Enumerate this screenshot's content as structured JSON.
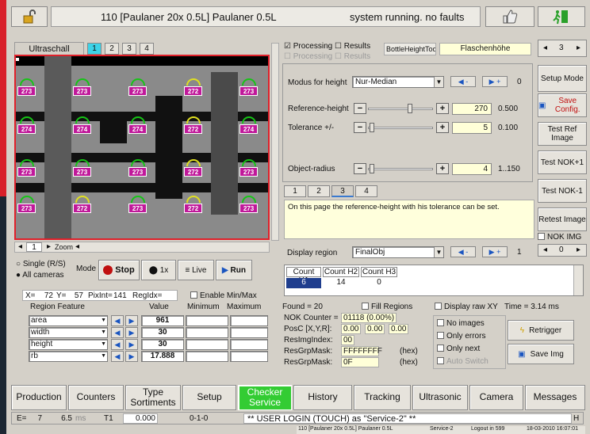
{
  "title_bar": {
    "product": "110 [Paulaner 20x 0.5L] Paulaner 0.5L",
    "status": "system running. no faults"
  },
  "left": {
    "tab_label": "Ultraschall",
    "cam_tabs": [
      "1",
      "2",
      "3",
      "4"
    ],
    "grid_values": [
      [
        "273",
        "273",
        "273",
        "272",
        "273"
      ],
      [
        "274",
        "274",
        "274",
        "272",
        "274"
      ],
      [
        "273",
        "273",
        "273",
        "272",
        "273"
      ],
      [
        "273",
        "272",
        "273",
        "272",
        "273"
      ]
    ],
    "nav_value": "1",
    "zoom_label": "Zoom",
    "single_label": "Single (R/S)",
    "all_label": "All cameras",
    "mode_label": "Mode",
    "stop_label": "Stop",
    "one_x_label": "1x",
    "live_label": "Live",
    "run_label": "Run",
    "coords": {
      "x_label": "X=",
      "x": "72",
      "y_label": "Y=",
      "y": "57",
      "pxint_label": "PixInt=",
      "pxint": "141",
      "reg_label": "RegIdx="
    },
    "enable_minmax": "Enable Min/Max",
    "region_feature_header": "Region Feature",
    "value_header": "Value",
    "minimum_header": "Minimum",
    "maximum_header": "Maximum",
    "features": [
      {
        "name": "area",
        "value": "961"
      },
      {
        "name": "width",
        "value": "30"
      },
      {
        "name": "height",
        "value": "30"
      },
      {
        "name": "rb",
        "value": "17.888"
      }
    ]
  },
  "right": {
    "processing": "Processing",
    "results": "Results",
    "processing2": "Processing",
    "results2": "Results",
    "tool": "BottleHeightTool",
    "tool_name": "Flaschenhöhe",
    "page_value": "3",
    "modus_label": "Modus for height",
    "modus_value": "Nur-Median",
    "modus_num": "0",
    "ref_label": "Reference-height",
    "ref_value": "270",
    "ref_factor": "0.500",
    "tol_label": "Tolerance +/-",
    "tol_value": "5",
    "tol_factor": "0.100",
    "obj_label": "Object-radius",
    "obj_value": "4",
    "obj_factor": "1..150",
    "page_tabs": [
      "1",
      "2",
      "3",
      "4"
    ],
    "info": "On this page the reference-height with his tolerance can be set.",
    "display_region_label": "Display region",
    "display_region_value": "FinalObj",
    "dr_num": "1",
    "counts": {
      "headers": [
        "Count H1",
        "Count H2",
        "Count H3"
      ],
      "values": [
        "6",
        "14",
        "0"
      ]
    },
    "found": "Found = 20",
    "fill_regions": "Fill Regions",
    "display_raw": "Display raw XY",
    "time": "Time = 3.14 ms",
    "nok_counter_label": "NOK Counter =",
    "nok_counter": "01118 (0.00%)",
    "posc_label": "PosC [X,Y,R]:",
    "posc": [
      "0.00",
      "0.00",
      "0.00"
    ],
    "resimg_label": "ResImgIndex:",
    "resimg": "00",
    "resgrp_label": "ResGrpMask:",
    "resgrp": "FFFFFFFF",
    "resgrp_unit": "(hex)",
    "resgrp2_label": "ResGrpMask:",
    "resgrp2": "0F",
    "resgrp2_unit": "(hex)",
    "no_images": "No images",
    "only_errors": "Only errors",
    "only_next": "Only next",
    "auto_switch": "Auto Switch",
    "retrigger": "Retrigger",
    "save_img": "Save Img"
  },
  "side": {
    "page_value": "3",
    "setup_mode": "Setup Mode",
    "save_config": "Save Config.",
    "test_ref": "Test Ref Image",
    "test_nok1": "Test NOK+1",
    "test_nok_1": "Test NOK-1",
    "retest": "Retest Image",
    "nok_img": "NOK IMG",
    "nok_img_value": "0"
  },
  "bottom_tabs": [
    "Production",
    "Counters",
    "Type Sortiments",
    "Setup",
    "Checker Service",
    "History",
    "Tracking",
    "Ultrasonic",
    "Camera",
    "Messages"
  ],
  "status": {
    "e_label": "E=",
    "e_value": "7",
    "ms_value": "6.5",
    "ms_unit": "ms",
    "t1_label": "T1",
    "t1_value": "0.000",
    "code": "0-1-0",
    "message": "** USER LOGIN (TOUCH) as \"Service-2\" **",
    "h": "H",
    "footer": [
      "110 [Paulaner 20x 0.5L] Paulaner 0.5L",
      "Service-2",
      "Logout in 599",
      "18-03-2010 16:07:01"
    ]
  },
  "colors": {
    "checker_service": "#33cc33",
    "image_border": "#e0202a",
    "stop": "#c01010"
  }
}
